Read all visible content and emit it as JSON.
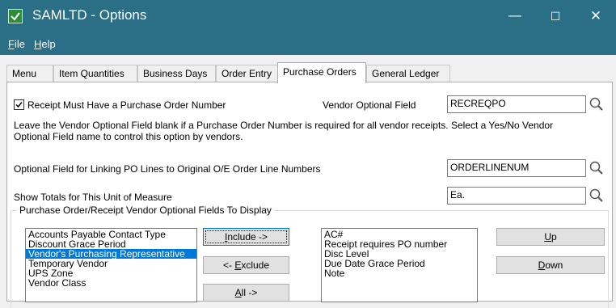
{
  "window": {
    "title": "SAMLTD - Options",
    "minimize": "—",
    "maximize": "☐",
    "close": "✕"
  },
  "menu": [
    {
      "letter": "F",
      "rest": "ile"
    },
    {
      "letter": "H",
      "rest": "elp"
    }
  ],
  "tabs": [
    "Menu",
    "Item Quantities",
    "Business Days",
    "Order Entry",
    "Purchase Orders",
    "General Ledger"
  ],
  "active_tab": "Purchase Orders",
  "po": {
    "receipt_check_label": "Receipt Must Have a Purchase Order Number",
    "receipt_checked": true,
    "vendor_optional_field_label": "Vendor Optional Field",
    "vendor_optional_field_value": "RECREQPO",
    "help_line1": "Leave the Vendor Optional Field blank if a Purchase Order Number is required for all vendor receipts. Select a Yes/No Vendor",
    "help_line2": "Optional Field name to control this option by vendors.",
    "linking_label": "Optional Field for Linking PO Lines to Original O/E Order Line Numbers",
    "linking_value": "ORDERLINENUM",
    "uom_label": "Show Totals for This Unit of Measure",
    "uom_value": "Ea.",
    "group_title": "Purchase Order/Receipt Vendor Optional Fields To Display",
    "available_fields": [
      "Accounts Payable Contact Type",
      "Discount Grace Period",
      "Vendor's Purchasing Representative",
      "Temporary Vendor",
      "UPS Zone",
      "Vendor Class"
    ],
    "selected_available": "Vendor's Purchasing Representative",
    "display_fields": [
      "AC#",
      "Receipt requires PO number",
      "Disc Level",
      "Due Date Grace Period",
      "Note"
    ],
    "buttons": {
      "include": {
        "letter": "I",
        "rest": "nclude ->"
      },
      "exclude": {
        "pre": "<- ",
        "letter": "E",
        "rest": "xclude"
      },
      "all": {
        "letter": "A",
        "rest": "ll ->"
      },
      "up": {
        "letter": "U",
        "rest": "p"
      },
      "down": {
        "letter": "D",
        "rest": "own"
      }
    }
  },
  "colors": {
    "titlebar": "#2a6f86",
    "selection": "#0078d7",
    "app_icon": "#2e8b3a"
  },
  "icons": {
    "app": "app-check-icon",
    "lookup": "magnifier-icon"
  }
}
